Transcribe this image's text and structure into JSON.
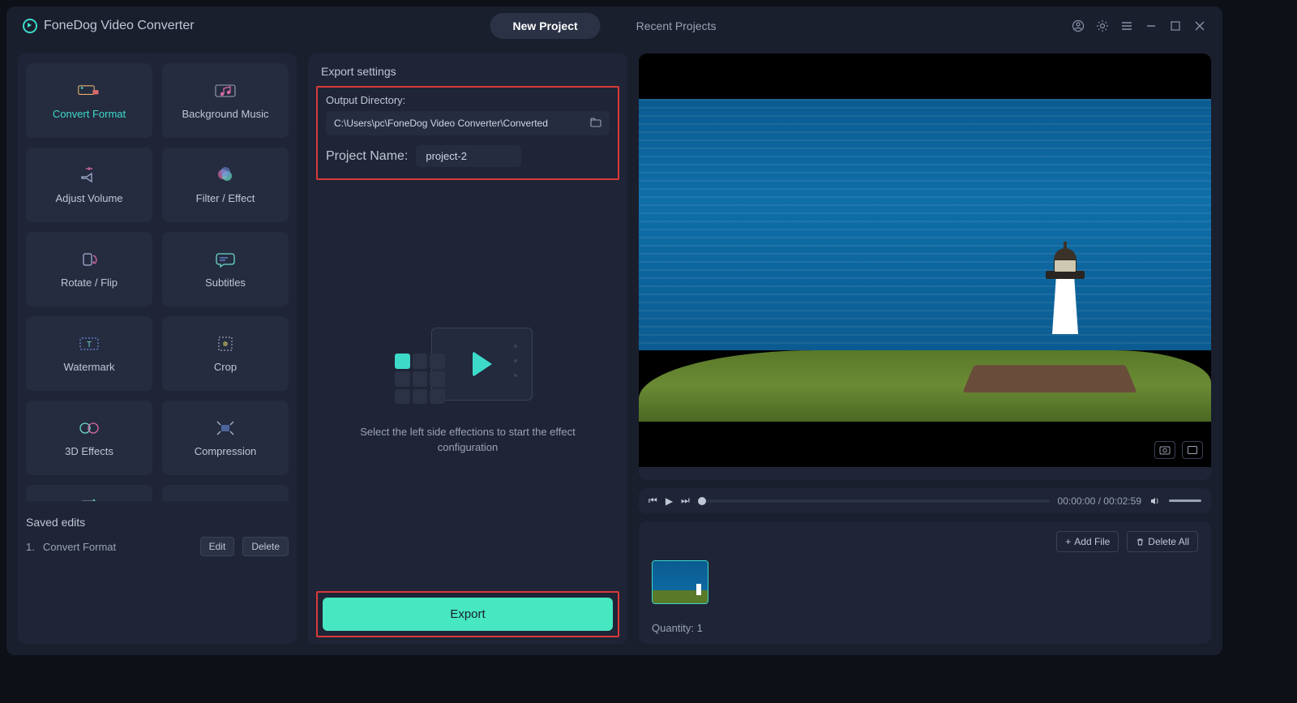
{
  "app": {
    "title": "FoneDog Video Converter"
  },
  "tabs": {
    "new_project": "New Project",
    "recent_projects": "Recent Projects"
  },
  "tools": [
    {
      "label": "Convert Format",
      "active": true
    },
    {
      "label": "Background Music",
      "active": false
    },
    {
      "label": "Adjust Volume",
      "active": false
    },
    {
      "label": "Filter / Effect",
      "active": false
    },
    {
      "label": "Rotate / Flip",
      "active": false
    },
    {
      "label": "Subtitles",
      "active": false
    },
    {
      "label": "Watermark",
      "active": false
    },
    {
      "label": "Crop",
      "active": false
    },
    {
      "label": "3D Effects",
      "active": false
    },
    {
      "label": "Compression",
      "active": false
    }
  ],
  "saved_edits": {
    "title": "Saved edits",
    "item_number": "1.",
    "item_label": "Convert Format",
    "edit": "Edit",
    "delete": "Delete"
  },
  "export_settings": {
    "title": "Export settings",
    "output_label": "Output Directory:",
    "output_path": "C:\\Users\\pc\\FoneDog Video Converter\\Converted",
    "project_name_label": "Project Name:",
    "project_name_value": "project-2",
    "hint": "Select the left side effections to start the effect configuration",
    "export_label": "Export"
  },
  "player": {
    "current_time": "00:00:00",
    "total_time": "00:02:59"
  },
  "file_list": {
    "add_file": "Add File",
    "delete_all": "Delete All",
    "quantity_label": "Quantity:",
    "quantity_value": "1"
  }
}
